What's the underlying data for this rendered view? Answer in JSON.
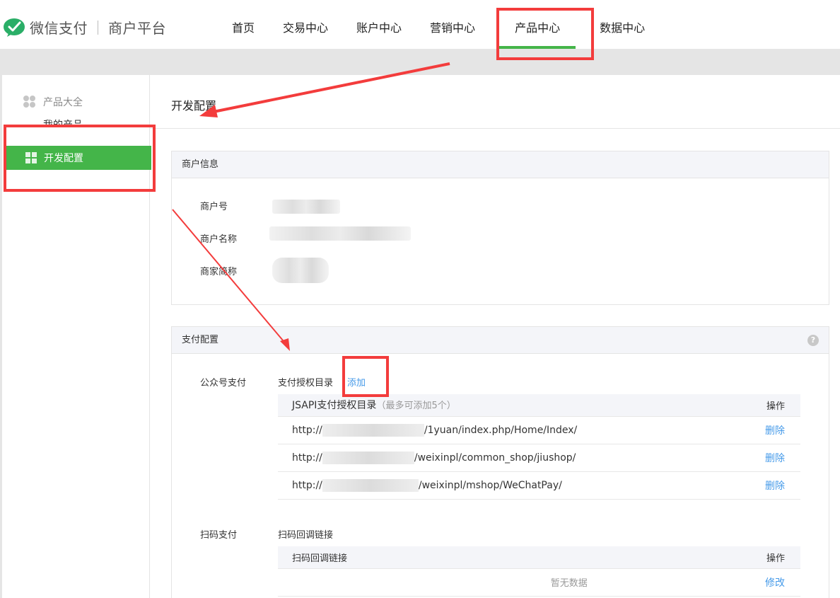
{
  "header": {
    "logo_text": "微信支付",
    "logo_sub": "商户平台",
    "nav": [
      "首页",
      "交易中心",
      "账户中心",
      "营销中心",
      "产品中心",
      "数据中心"
    ],
    "active_nav": "产品中心"
  },
  "sidebar": {
    "category": "产品大全",
    "my_products": "我的产品",
    "active_item": "开发配置"
  },
  "main": {
    "title": "开发配置",
    "merchant_info": {
      "heading": "商户信息",
      "rows": [
        "商户号",
        "商户名称",
        "商家简称"
      ]
    },
    "pay_config": {
      "heading": "支付配置",
      "help": "?",
      "jsapi": {
        "label": "公众号支付",
        "dir_label": "支付授权目录",
        "add": "添加",
        "table_head": "JSAPI支付授权目录",
        "table_note": "（最多可添加5个）",
        "op_head": "操作",
        "rows": [
          {
            "prefix": "http://",
            "suffix": "/1yuan/index.php/Home/Index/",
            "action": "删除"
          },
          {
            "prefix": "http://",
            "suffix": "/weixinpl/common_shop/jiushop/",
            "action": "删除"
          },
          {
            "prefix": "http://",
            "suffix": "/weixinpl/mshop/WeChatPay/",
            "action": "删除"
          }
        ]
      },
      "native": {
        "label": "扫码支付",
        "link_label": "扫码回调链接",
        "table_head": "扫码回调链接",
        "op_head": "操作",
        "empty": "暂无数据",
        "action": "修改"
      }
    }
  },
  "colors": {
    "accent": "#44b549",
    "link": "#459ae9",
    "annotation": "#f33c3c"
  }
}
